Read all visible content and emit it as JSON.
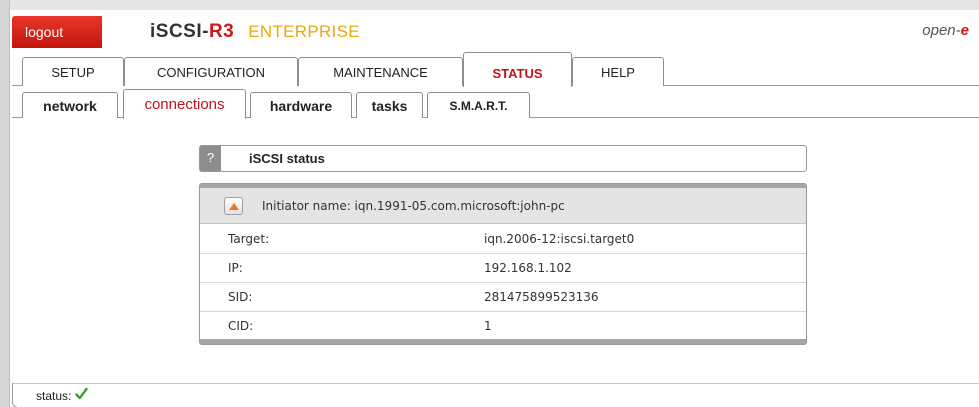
{
  "header": {
    "logout_label": "logout",
    "brand_product": "iSCSI-",
    "brand_version": "R3",
    "brand_edition": "ENTERPRISE",
    "vendor_prefix": "open-",
    "vendor_suffix": "e"
  },
  "main_tabs": [
    {
      "label": "SETUP",
      "active": false
    },
    {
      "label": "CONFIGURATION",
      "active": false
    },
    {
      "label": "MAINTENANCE",
      "active": false
    },
    {
      "label": "STATUS",
      "active": true
    },
    {
      "label": "HELP",
      "active": false
    }
  ],
  "sub_tabs": [
    {
      "label": "network",
      "active": false
    },
    {
      "label": "connections",
      "active": true
    },
    {
      "label": "hardware",
      "active": false
    },
    {
      "label": "tasks",
      "active": false
    },
    {
      "label": "S.M.A.R.T.",
      "active": false
    }
  ],
  "section": {
    "help_label": "?",
    "title": "iSCSI status"
  },
  "panel": {
    "initiator_text": "Initiator name: iqn.1991-05.com.microsoft:john-pc",
    "rows": [
      {
        "label": "Target:",
        "value": "iqn.2006-12:iscsi.target0"
      },
      {
        "label": "IP:",
        "value": "192.168.1.102"
      },
      {
        "label": "SID:",
        "value": "281475899523136"
      },
      {
        "label": "CID:",
        "value": "1"
      }
    ]
  },
  "status_bar": {
    "label": "status:",
    "state": "ok"
  },
  "colors": {
    "brand_red": "#c21318",
    "accent_orange": "#e8a90e",
    "ok_green": "#3aa12a"
  },
  "icons": {
    "collapse": "chevron-up-icon",
    "status": "checkmark-icon"
  }
}
